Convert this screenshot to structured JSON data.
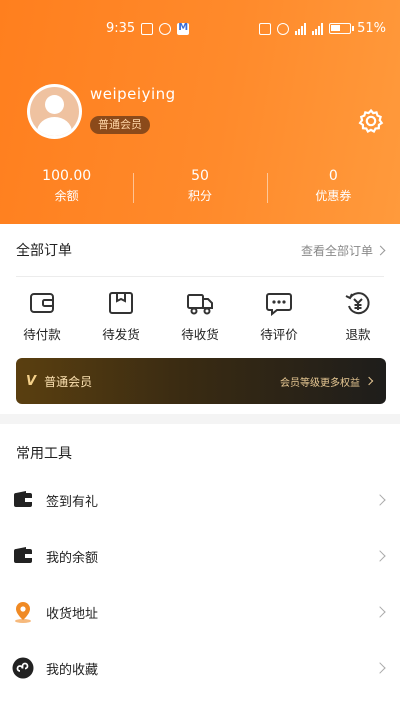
{
  "status_bar": {
    "time": "9:35",
    "battery": "51%",
    "network": "46"
  },
  "profile": {
    "username": "weipeiying",
    "member_level": "普通会员"
  },
  "stats": [
    {
      "value": "100.00",
      "label": "余额"
    },
    {
      "value": "50",
      "label": "积分"
    },
    {
      "value": "0",
      "label": "优惠券"
    }
  ],
  "orders": {
    "title": "全部订单",
    "view_all": "查看全部订单",
    "items": [
      {
        "label": "待付款",
        "icon": "wallet-icon"
      },
      {
        "label": "待发货",
        "icon": "package-icon"
      },
      {
        "label": "待收货",
        "icon": "truck-icon"
      },
      {
        "label": "待评价",
        "icon": "comment-icon"
      },
      {
        "label": "退款",
        "icon": "refund-icon"
      }
    ]
  },
  "vip_banner": {
    "level": "普通会员",
    "link": "会员等级更多权益"
  },
  "tools": {
    "title": "常用工具",
    "items": [
      {
        "label": "签到有礼",
        "icon": "wallet-icon"
      },
      {
        "label": "我的余额",
        "icon": "wallet-icon"
      },
      {
        "label": "收货地址",
        "icon": "location-icon"
      },
      {
        "label": "我的收藏",
        "icon": "collection-icon"
      }
    ]
  },
  "colors": {
    "primary": "#ff7f1e",
    "vip_gold": "#f4d08a",
    "vip_dark": "#1e1d1b"
  }
}
